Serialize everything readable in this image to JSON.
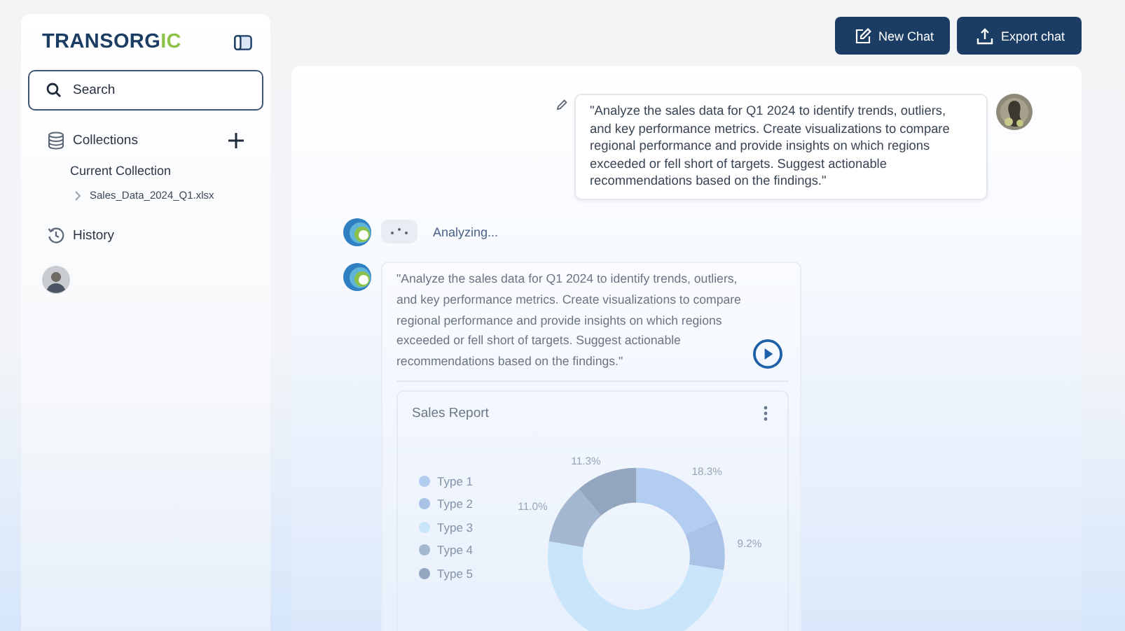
{
  "sidebar": {
    "logo": {
      "text": "TRANSORG",
      "accent": "IC"
    },
    "search": {
      "placeholder": "Search"
    },
    "collections": {
      "label": "Collections",
      "current": "Current Collection",
      "files": [
        "Sales_Data_2024_Q1.xlsx"
      ]
    },
    "history": "History"
  },
  "header": {
    "buttons": [
      {
        "label": "New Chat",
        "kind": "new"
      },
      {
        "label": "Export chat",
        "kind": "export"
      }
    ]
  },
  "chat": {
    "messages": [
      {
        "kind": "user",
        "text": "\"Analyze the sales data for Q1 2024 to identify trends, outliers, and key performance metrics. Create visualizations to compare regional performance and provide insights on which regions exceeded or fell short of targets. Suggest actionable recommendations based on the findings.\""
      },
      {
        "kind": "status",
        "text": "Analyzing..."
      },
      {
        "kind": "bot",
        "text": "\"Analyze the sales data for Q1 2024 to identify trends, outliers, and key performance metrics. Create visualizations to compare regional performance and provide insights on which regions exceeded or fell short of targets. Suggest actionable recommendations based on the findings.\"",
        "report": {
          "legend": [
            {
              "color": "#b3cdf0"
            },
            {
              "color": "#a9c2e6"
            },
            {
              "color": "#c9e5fb"
            },
            {
              "color": "#a3b8d0"
            },
            {
              "color": "#93a6bf"
            }
          ],
          "chart_data": {
            "type": "donut",
            "title": "Sales Report",
            "categories": [
              "Type 1",
              "Type 2",
              "Type 3",
              "Type 4",
              "Type 5"
            ],
            "values": [
              18.3,
              9.2,
              50.2,
              11.0,
              11.3
            ],
            "value_labels": [
              "18.3%",
              "9.2%",
              null,
              "11.0%",
              "11.3%"
            ],
            "legend": "left"
          }
        }
      }
    ]
  }
}
